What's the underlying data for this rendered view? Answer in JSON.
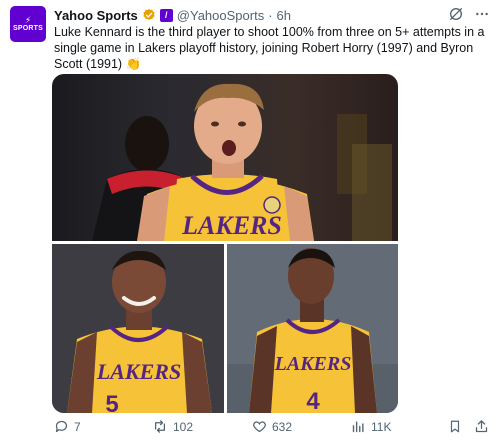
{
  "account": {
    "display_name": "Yahoo Sports",
    "handle": "@YahooSports",
    "separator": "·",
    "time_ago": "6h",
    "avatar_text": "SPORTS",
    "avatar_mark": "⚡",
    "affiliate_badge": "/",
    "brand_color": "#6001d2",
    "verified_color": "#e8a200"
  },
  "tweet": {
    "text": "Luke Kennard is the third player to shoot 100% from three on 5+ attempts in a single game in Lakers playoff history, joining Robert Horry (1997) and Byron Scott (1991) 👏"
  },
  "media": {
    "photos": [
      {
        "jersey_text": "LAKERS"
      },
      {
        "jersey_text": "LAKERS",
        "number": "5"
      },
      {
        "jersey_text": "LAKERS",
        "number": "4"
      }
    ],
    "jersey_color": "#f6c338",
    "jersey_text_color": "#552583"
  },
  "actions": {
    "replies": "7",
    "reposts": "102",
    "likes": "632",
    "views": "11K"
  },
  "icons": {
    "grok": "grok-icon",
    "more": "more-icon",
    "reply": "reply-icon",
    "repost": "repost-icon",
    "like": "heart-icon",
    "views": "views-chart-icon",
    "bookmark": "bookmark-icon",
    "share": "share-icon"
  }
}
